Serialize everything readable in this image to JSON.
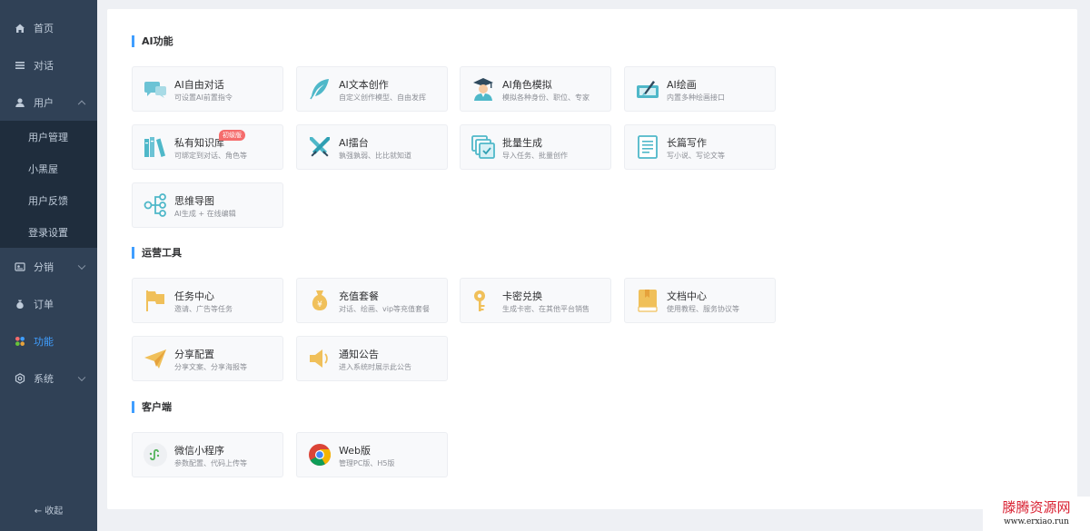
{
  "sidebar": {
    "items": [
      {
        "label": "首页"
      },
      {
        "label": "对话"
      },
      {
        "label": "用户"
      },
      {
        "label": "分销"
      },
      {
        "label": "订单"
      },
      {
        "label": "功能"
      },
      {
        "label": "系统"
      }
    ],
    "user_sub": [
      "用户管理",
      "小黑屋",
      "用户反馈",
      "登录设置"
    ],
    "collapse_label": "收起",
    "active_color": "#409eff"
  },
  "sections": {
    "ai": {
      "title": "AI功能",
      "cards": [
        {
          "title": "AI自由对话",
          "desc": "可设置AI前置指令",
          "icon": "chat-bubbles-icon"
        },
        {
          "title": "AI文本创作",
          "desc": "自定义创作模型、自由发挥",
          "icon": "feather-icon"
        },
        {
          "title": "AI角色模拟",
          "desc": "模拟各种身份、职位、专家",
          "icon": "graduate-icon"
        },
        {
          "title": "AI绘画",
          "desc": "内置多种绘画接口",
          "icon": "paint-icon"
        },
        {
          "title": "私有知识库",
          "desc": "可绑定到对话、角色等",
          "icon": "books-icon",
          "badge": "初级版"
        },
        {
          "title": "AI擂台",
          "desc": "孰强孰弱、比比就知道",
          "icon": "swords-icon"
        },
        {
          "title": "批量生成",
          "desc": "导入任务、批量创作",
          "icon": "batch-icon"
        },
        {
          "title": "长篇写作",
          "desc": "写小说、写论文等",
          "icon": "document-icon"
        },
        {
          "title": "思维导图",
          "desc": "AI生成 + 在线编辑",
          "icon": "mindmap-icon"
        }
      ]
    },
    "ops": {
      "title": "运营工具",
      "cards": [
        {
          "title": "任务中心",
          "desc": "邀请、广告等任务",
          "icon": "flag-icon"
        },
        {
          "title": "充值套餐",
          "desc": "对话、绘画、vip等充值套餐",
          "icon": "money-bag-icon"
        },
        {
          "title": "卡密兑换",
          "desc": "生成卡密、在其他平台销售",
          "icon": "key-icon"
        },
        {
          "title": "文档中心",
          "desc": "使用教程、服务协议等",
          "icon": "book-icon"
        },
        {
          "title": "分享配置",
          "desc": "分享文案、分享海报等",
          "icon": "paper-plane-icon"
        },
        {
          "title": "通知公告",
          "desc": "进入系统时展示此公告",
          "icon": "speaker-icon"
        }
      ]
    },
    "client": {
      "title": "客户端",
      "cards": [
        {
          "title": "微信小程序",
          "desc": "参数配置、代码上传等",
          "icon": "mini-program-icon"
        },
        {
          "title": "Web版",
          "desc": "管理PC版、H5版",
          "icon": "chrome-icon"
        }
      ]
    }
  },
  "watermark": {
    "line1": "滕腾资源网",
    "line2": "www.erxiao.run"
  }
}
